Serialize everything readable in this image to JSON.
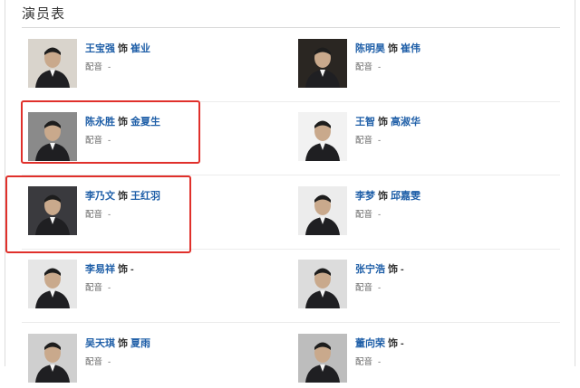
{
  "section_title": "演员表",
  "as_word": "饰",
  "dub_label": "配音",
  "cast": [
    {
      "actor": "王宝强",
      "role": "崔业",
      "dub": "-",
      "photo_bg": "#d9d4cc"
    },
    {
      "actor": "陈明昊",
      "role": "崔伟",
      "dub": "-",
      "photo_bg": "#2a2622"
    },
    {
      "actor": "陈永胜",
      "role": "金夏生",
      "dub": "-",
      "photo_bg": "#8a8a8a"
    },
    {
      "actor": "王智",
      "role": "高淑华",
      "dub": "-",
      "photo_bg": "#f2f2f2"
    },
    {
      "actor": "李乃文",
      "role": "王红羽",
      "dub": "-",
      "photo_bg": "#3a3a3e"
    },
    {
      "actor": "李梦",
      "role": "邱嘉雯",
      "dub": "-",
      "photo_bg": "#ececec"
    },
    {
      "actor": "李易祥",
      "role": "-",
      "dub": "-",
      "photo_bg": "#e6e6e6"
    },
    {
      "actor": "张宁浩",
      "role": "-",
      "dub": "-",
      "photo_bg": "#dcdcdc"
    },
    {
      "actor": "吴天琪",
      "role": "夏雨",
      "dub": "-",
      "photo_bg": "#cfcfcf"
    },
    {
      "actor": "董向荣",
      "role": "-",
      "dub": "-",
      "photo_bg": "#bdbdbd"
    }
  ],
  "colors": {
    "link": "#1f5fa8",
    "highlight": "#e0302b"
  },
  "highlighted_cards": [
    2,
    4
  ]
}
